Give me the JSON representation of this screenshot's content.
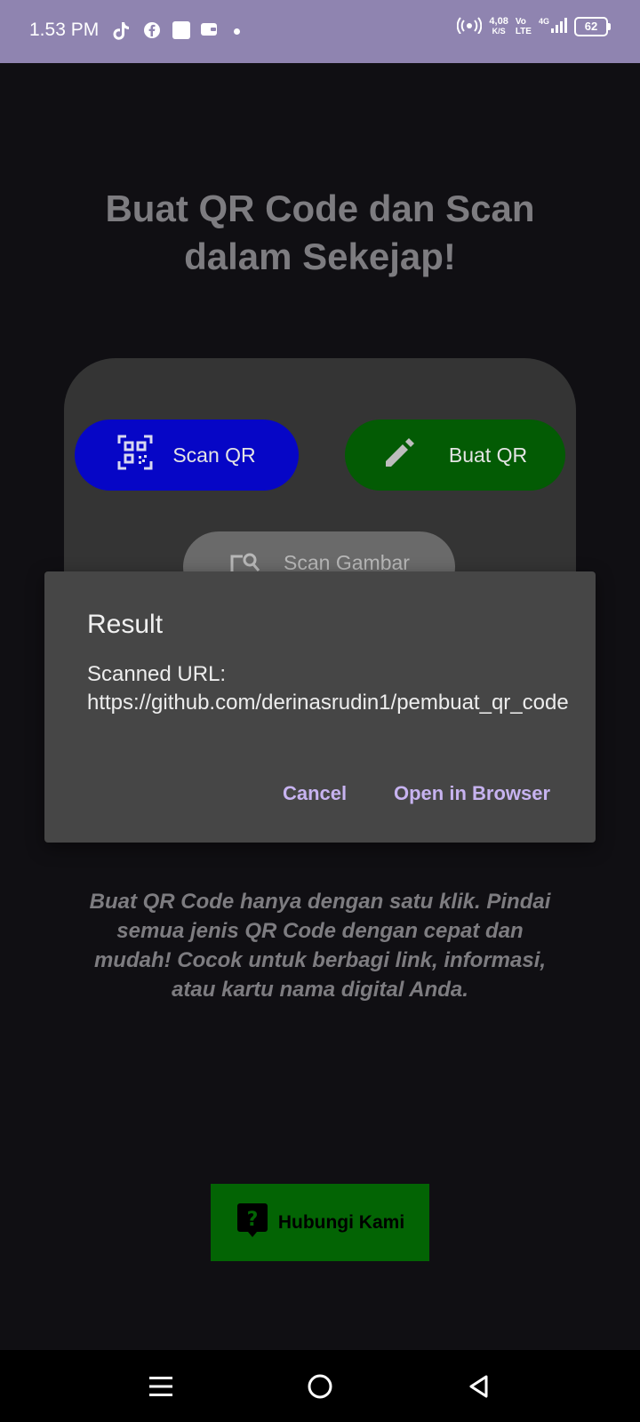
{
  "status_bar": {
    "time": "1.53 PM",
    "speed_value": "4,08",
    "speed_unit": "K/S",
    "volte": "Vo\nLTE",
    "network": "4G",
    "battery": "62"
  },
  "main": {
    "headline": "Buat QR Code dan Scan dalam Sekejap!",
    "scan_qr_label": "Scan QR",
    "buat_qr_label": "Buat QR",
    "scan_gambar_label": "Scan Gambar",
    "description": "Buat QR Code hanya dengan satu klik. Pindai semua jenis QR Code dengan cepat dan mudah! Cocok untuk berbagi link, informasi, atau kartu nama digital Anda.",
    "contact_label": "Hubungi Kami"
  },
  "dialog": {
    "title": "Result",
    "body": "Scanned URL: https://github.com/derinasrudin1/pembuat_qr_code",
    "cancel_label": "Cancel",
    "open_label": "Open in Browser"
  },
  "colors": {
    "scan_qr_button": "#0606c6",
    "buat_qr_button": "#035b04",
    "contact_button": "#036404",
    "dialog_accent": "#c7b3f0",
    "status_bar": "#8f84b0"
  },
  "icons": [
    "tiktok-icon",
    "facebook-icon",
    "app-icon",
    "wallet-icon",
    "hotspot-icon",
    "signal-icon",
    "qr-scan-icon",
    "pencil-icon",
    "image-search-icon",
    "help-bubble-icon",
    "menu-icon",
    "home-icon",
    "back-icon"
  ]
}
